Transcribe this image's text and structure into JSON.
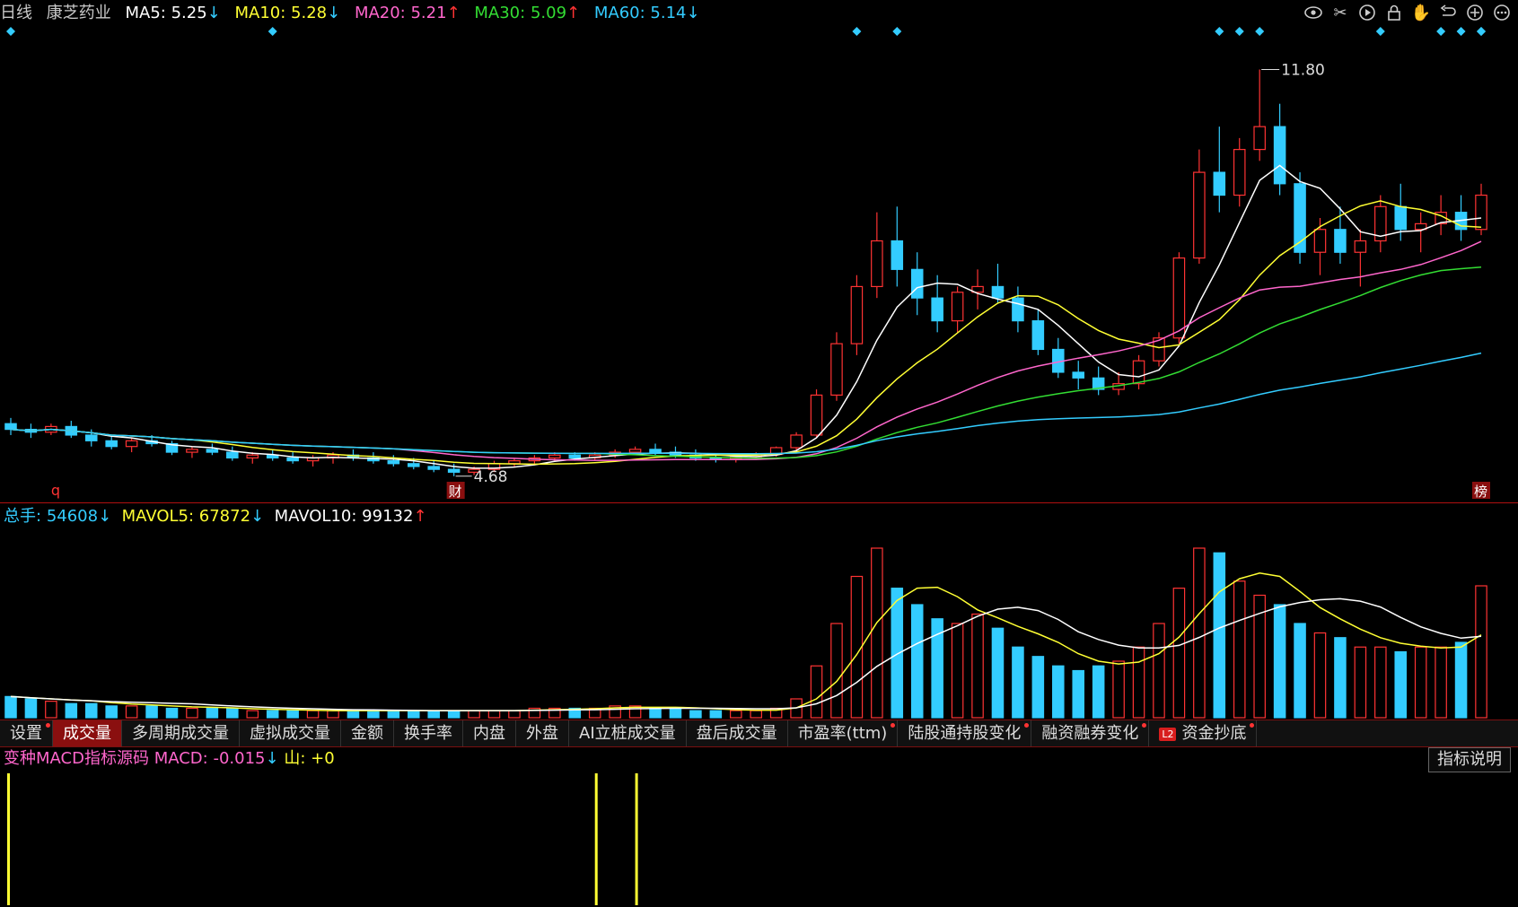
{
  "header": {
    "period": "日线",
    "stock_name": "康芝药业",
    "ma5": {
      "label": "MA5:",
      "value": "5.25",
      "arrow": "↓"
    },
    "ma10": {
      "label": "MA10:",
      "value": "5.28",
      "arrow": "↓"
    },
    "ma20": {
      "label": "MA20:",
      "value": "5.21",
      "arrow": "↑"
    },
    "ma30": {
      "label": "MA30:",
      "value": "5.09",
      "arrow": "↑"
    },
    "ma60": {
      "label": "MA60:",
      "value": "5.14",
      "arrow": "↓"
    }
  },
  "toolbar_icons": [
    "eye-icon",
    "scissors-icon",
    "play-icon",
    "lock-icon",
    "hand-icon",
    "undo-icon",
    "plus-circle-icon",
    "more-icon"
  ],
  "price_chart": {
    "high_label": "11.80",
    "low_label": "4.68",
    "marker_q": "q",
    "marker_cai": "财",
    "marker_bang": "榜",
    "colors": {
      "up": "#ff3333",
      "down": "#33ccff",
      "ma5": "#ffffff",
      "ma10": "#ffff33",
      "ma20": "#ff66cc",
      "ma30": "#33dd33",
      "ma60": "#33ccff"
    }
  },
  "volume_header": {
    "total_label": "总手:",
    "total_value": "54608",
    "total_arrow": "↓",
    "mavol5_label": "MAVOL5:",
    "mavol5_value": "67872",
    "mavol5_arrow": "↓",
    "mavol10_label": "MAVOL10:",
    "mavol10_value": "99132",
    "mavol10_arrow": "↑"
  },
  "tabs": [
    {
      "label": "设置",
      "dot": true
    },
    {
      "label": "成交量",
      "dot": false,
      "active": true
    },
    {
      "label": "多周期成交量",
      "dot": false
    },
    {
      "label": "虚拟成交量",
      "dot": false
    },
    {
      "label": "金额",
      "dot": false
    },
    {
      "label": "换手率",
      "dot": false
    },
    {
      "label": "内盘",
      "dot": false
    },
    {
      "label": "外盘",
      "dot": false
    },
    {
      "label": "AI立桩成交量",
      "dot": false
    },
    {
      "label": "盘后成交量",
      "dot": false
    },
    {
      "label": "市盈率(ttm)",
      "dot": true
    },
    {
      "label": "陆股通持股变化",
      "dot": true
    },
    {
      "label": "融资融券变化",
      "dot": true
    },
    {
      "label": "资金抄底",
      "dot": true,
      "badge": "L2"
    }
  ],
  "macd_header": {
    "name": "变种MACD指标源码",
    "macd_label": "MACD:",
    "macd_value": "-0.015",
    "macd_arrow": "↓",
    "shan_label": "山:",
    "shan_value": "+0"
  },
  "help_button": "指标说明",
  "chart_data": {
    "type": "candlestick",
    "title": "康芝药业 日线",
    "high_marker": 11.8,
    "low_marker": 4.68,
    "candles": [
      [
        5.6,
        5.7,
        5.4,
        5.5
      ],
      [
        5.5,
        5.6,
        5.35,
        5.45
      ],
      [
        5.45,
        5.6,
        5.4,
        5.55
      ],
      [
        5.55,
        5.65,
        5.35,
        5.4
      ],
      [
        5.4,
        5.5,
        5.2,
        5.3
      ],
      [
        5.3,
        5.4,
        5.15,
        5.2
      ],
      [
        5.2,
        5.35,
        5.1,
        5.3
      ],
      [
        5.3,
        5.4,
        5.2,
        5.25
      ],
      [
        5.25,
        5.3,
        5.05,
        5.1
      ],
      [
        5.1,
        5.2,
        5.0,
        5.15
      ],
      [
        5.15,
        5.25,
        5.05,
        5.1
      ],
      [
        5.1,
        5.2,
        4.95,
        5.0
      ],
      [
        5.0,
        5.1,
        4.9,
        5.05
      ],
      [
        5.05,
        5.15,
        4.95,
        5.0
      ],
      [
        5.0,
        5.1,
        4.9,
        4.95
      ],
      [
        4.95,
        5.05,
        4.85,
        5.0
      ],
      [
        5.0,
        5.1,
        4.9,
        5.05
      ],
      [
        5.05,
        5.15,
        4.95,
        5.0
      ],
      [
        5.0,
        5.1,
        4.9,
        4.95
      ],
      [
        4.95,
        5.05,
        4.85,
        4.9
      ],
      [
        4.9,
        5.0,
        4.8,
        4.85
      ],
      [
        4.85,
        4.95,
        4.75,
        4.8
      ],
      [
        4.8,
        4.9,
        4.68,
        4.75
      ],
      [
        4.75,
        4.85,
        4.7,
        4.8
      ],
      [
        4.8,
        4.95,
        4.75,
        4.9
      ],
      [
        4.9,
        5.0,
        4.85,
        4.95
      ],
      [
        4.95,
        5.05,
        4.9,
        5.0
      ],
      [
        5.0,
        5.1,
        4.95,
        5.05
      ],
      [
        5.05,
        5.1,
        4.95,
        5.0
      ],
      [
        5.0,
        5.1,
        4.95,
        5.05
      ],
      [
        5.05,
        5.15,
        5.0,
        5.1
      ],
      [
        5.1,
        5.2,
        5.05,
        5.15
      ],
      [
        5.15,
        5.25,
        5.05,
        5.1
      ],
      [
        5.1,
        5.2,
        5.0,
        5.05
      ],
      [
        5.05,
        5.15,
        4.95,
        5.0
      ],
      [
        5.0,
        5.05,
        4.92,
        4.98
      ],
      [
        4.98,
        5.05,
        4.92,
        5.02
      ],
      [
        5.02,
        5.1,
        4.98,
        5.06
      ],
      [
        5.06,
        5.2,
        5.02,
        5.18
      ],
      [
        5.18,
        5.45,
        5.1,
        5.4
      ],
      [
        5.4,
        6.2,
        5.35,
        6.1
      ],
      [
        6.1,
        7.2,
        6.0,
        7.0
      ],
      [
        7.0,
        8.2,
        6.8,
        8.0
      ],
      [
        8.0,
        9.3,
        7.8,
        8.8
      ],
      [
        8.8,
        9.4,
        8.0,
        8.3
      ],
      [
        8.3,
        8.6,
        7.5,
        7.8
      ],
      [
        7.8,
        8.2,
        7.2,
        7.4
      ],
      [
        7.4,
        8.0,
        7.2,
        7.9
      ],
      [
        7.9,
        8.3,
        7.6,
        8.0
      ],
      [
        8.0,
        8.4,
        7.7,
        7.8
      ],
      [
        7.8,
        8.0,
        7.2,
        7.4
      ],
      [
        7.4,
        7.6,
        6.8,
        6.9
      ],
      [
        6.9,
        7.1,
        6.4,
        6.5
      ],
      [
        6.5,
        6.7,
        6.2,
        6.4
      ],
      [
        6.4,
        6.6,
        6.1,
        6.2
      ],
      [
        6.2,
        6.5,
        6.1,
        6.3
      ],
      [
        6.3,
        6.8,
        6.2,
        6.7
      ],
      [
        6.7,
        7.2,
        6.6,
        7.1
      ],
      [
        7.1,
        8.6,
        7.0,
        8.5
      ],
      [
        8.5,
        10.4,
        8.4,
        10.0
      ],
      [
        10.0,
        10.8,
        9.3,
        9.6
      ],
      [
        9.6,
        10.6,
        9.4,
        10.4
      ],
      [
        10.4,
        11.8,
        10.2,
        10.8
      ],
      [
        10.8,
        11.2,
        9.6,
        9.8
      ],
      [
        9.8,
        10.0,
        8.4,
        8.6
      ],
      [
        8.6,
        9.2,
        8.2,
        9.0
      ],
      [
        9.0,
        9.4,
        8.4,
        8.6
      ],
      [
        8.6,
        9.0,
        8.0,
        8.8
      ],
      [
        8.8,
        9.6,
        8.6,
        9.4
      ],
      [
        9.4,
        9.8,
        8.8,
        9.0
      ],
      [
        9.0,
        9.3,
        8.6,
        9.1
      ],
      [
        9.1,
        9.6,
        8.9,
        9.3
      ],
      [
        9.3,
        9.6,
        8.8,
        9.0
      ],
      [
        9.0,
        9.8,
        8.9,
        9.6
      ]
    ],
    "volume": [
      9,
      8,
      7,
      6,
      6,
      5,
      5,
      5,
      4,
      4,
      4,
      4,
      3,
      3,
      3,
      3,
      3,
      3,
      3,
      3,
      3,
      3,
      3,
      3,
      3,
      3,
      4,
      4,
      4,
      4,
      5,
      5,
      4,
      4,
      3,
      3,
      3,
      3,
      4,
      8,
      22,
      40,
      60,
      72,
      55,
      48,
      42,
      40,
      44,
      38,
      30,
      26,
      22,
      20,
      22,
      24,
      30,
      40,
      55,
      72,
      70,
      58,
      52,
      48,
      40,
      36,
      34,
      30,
      30,
      28,
      30,
      30,
      32,
      56
    ],
    "macd_bars": [
      {
        "index": 0,
        "value": 1
      },
      {
        "index": 29,
        "value": 1
      },
      {
        "index": 31,
        "value": 1
      }
    ]
  }
}
